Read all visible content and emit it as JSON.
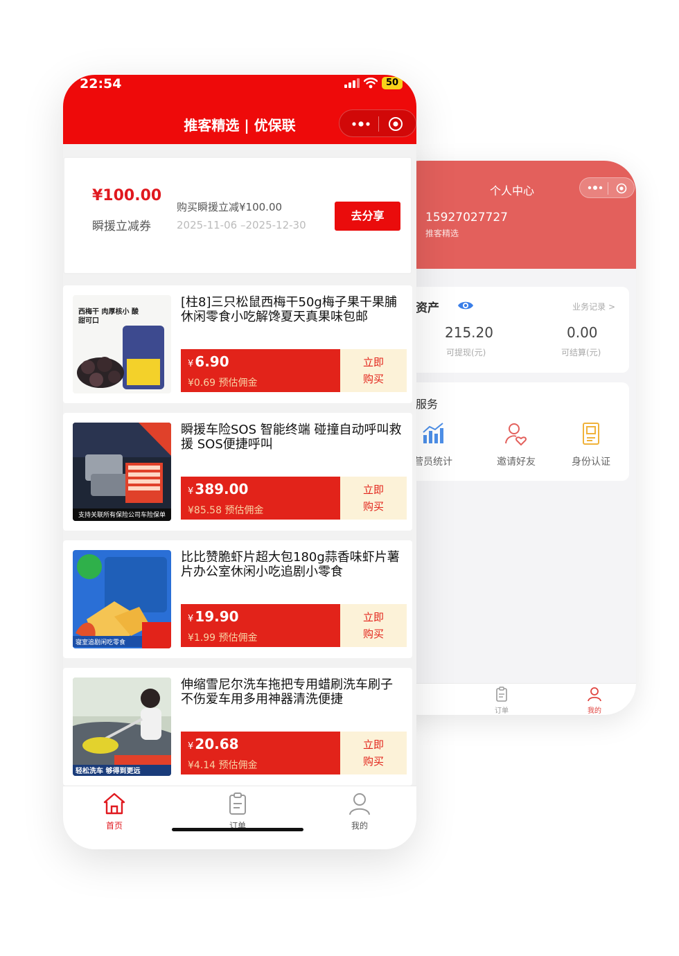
{
  "back_screen": {
    "title": "个人中心",
    "phone_number": "15927027727",
    "subtitle": "推客精选",
    "assets": {
      "title": "资产",
      "link": "业务记录 >",
      "withdrawable_value": "215.20",
      "withdrawable_label": "可提现(元)",
      "settle_value": "0.00",
      "settle_label": "可结算(元)"
    },
    "services": {
      "title": "服务",
      "items": [
        {
          "label": "营员统计",
          "icon": "bar-chart-icon"
        },
        {
          "label": "邀请好友",
          "icon": "invite-friend-icon"
        },
        {
          "label": "身份认证",
          "icon": "id-document-icon"
        }
      ]
    },
    "tabbar": [
      {
        "label": "订单",
        "icon": "clipboard-icon"
      },
      {
        "label": "我的",
        "icon": "user-icon",
        "active": true
      }
    ]
  },
  "front_screen": {
    "status_bar": {
      "time": "22:54",
      "battery": "50"
    },
    "title": "推客精选 | 优保联",
    "coupon": {
      "amount": "¥100.00",
      "name": "瞬援立减券",
      "description": "购买瞬援立减¥100.00",
      "date_range": "2025-11-06 –2025-12-30",
      "share_label": "去分享"
    },
    "products": [
      {
        "title": "[柱8]三只松鼠西梅干50g梅子果干果脯休闲零食小吃解馋夏天真果味包邮",
        "price": "6.90",
        "commission": "¥0.69  预估佣金",
        "buy_label_1": "立即",
        "buy_label_2": "购买",
        "thumb_text": "西梅干 肉厚核小 酸甜可口"
      },
      {
        "title": "瞬援车险SOS 智能终端 碰撞自动呼叫救援 SOS便捷呼叫",
        "price": "389.00",
        "commission": "¥85.58  预估佣金",
        "buy_label_1": "立即",
        "buy_label_2": "购买",
        "thumb_text": "支持关联所有保险公司车险保单"
      },
      {
        "title": "比比赞脆虾片超大包180g蒜香味虾片薯片办公室休闲小吃追剧小零食",
        "price": "19.90",
        "commission": "¥1.99  预估佣金",
        "buy_label_1": "立即",
        "buy_label_2": "购买",
        "thumb_text": "寝室追剧闲吃零食"
      },
      {
        "title": "伸缩雪尼尔洗车拖把专用蜡刷洗车刷子不伤爱车用多用神器清洗便捷",
        "price": "20.68",
        "commission": "¥4.14  预估佣金",
        "buy_label_1": "立即",
        "buy_label_2": "购买",
        "thumb_text": "轻松洗车 够得到更远"
      }
    ],
    "currency_symbol": "¥",
    "tabbar": [
      {
        "label": "首页",
        "icon": "home-icon",
        "active": true
      },
      {
        "label": "订单",
        "icon": "clipboard-icon"
      },
      {
        "label": "我的",
        "icon": "user-icon"
      }
    ]
  },
  "colors": {
    "brand_red": "#ee0a0a",
    "price_red": "#e2231a",
    "back_header": "#e3605c",
    "buy_bg": "#fcf2d8"
  }
}
